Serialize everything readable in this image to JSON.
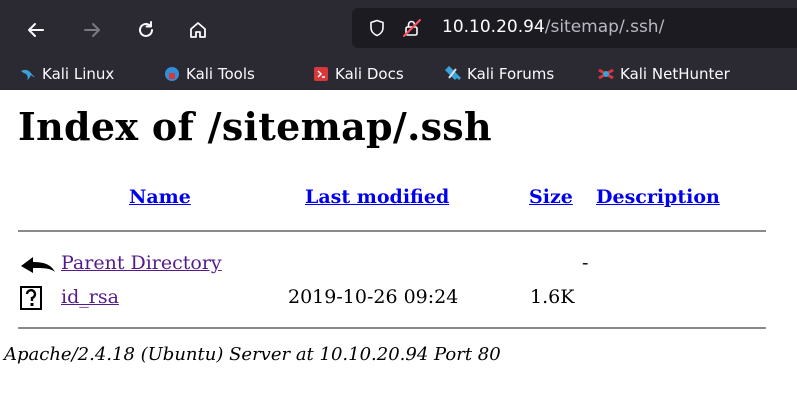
{
  "browser": {
    "url_host": "10.10.20.94",
    "url_path": "/sitemap/.ssh/",
    "bookmarks": [
      {
        "label": "Kali Linux",
        "icon": "kali-dragon-icon"
      },
      {
        "label": "Kali Tools",
        "icon": "kali-tools-icon"
      },
      {
        "label": "Kali Docs",
        "icon": "kali-docs-icon"
      },
      {
        "label": "Kali Forums",
        "icon": "kali-forums-icon"
      },
      {
        "label": "Kali NetHunter",
        "icon": "kali-nethunter-icon"
      }
    ]
  },
  "page": {
    "title": "Index of /sitemap/.ssh",
    "columns": {
      "name": "Name",
      "modified": "Last modified",
      "size": "Size",
      "description": "Description"
    },
    "rows": [
      {
        "name": "Parent Directory",
        "modified": "",
        "size": "-",
        "icon": "back-folder-icon"
      },
      {
        "name": "id_rsa",
        "modified": "2019-10-26 09:24",
        "size": "1.6K",
        "icon": "unknown-file-icon"
      }
    ],
    "footer": "Apache/2.4.18 (Ubuntu) Server at 10.10.20.94 Port 80"
  },
  "colors": {
    "chrome_bg": "#2b2a33",
    "urlbar_bg": "#1c1b22",
    "link": "#0000ee",
    "visited": "#551a8b"
  }
}
